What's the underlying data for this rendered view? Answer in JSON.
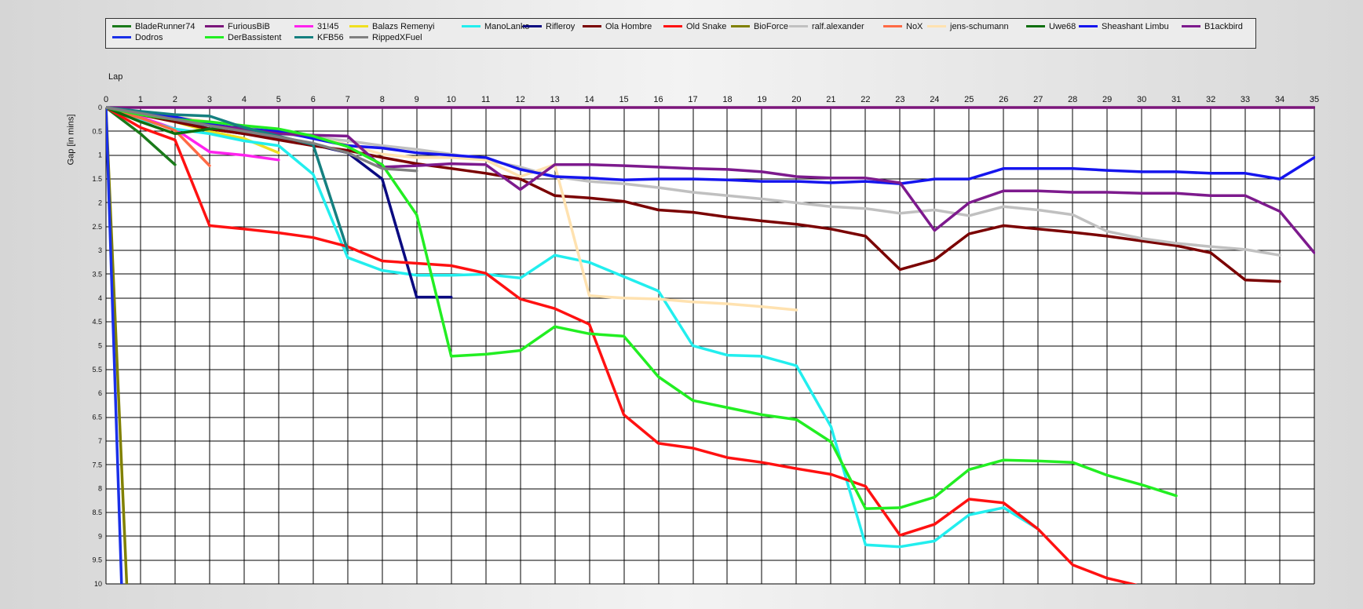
{
  "chart_data": {
    "type": "line",
    "xlabel": "Lap",
    "ylabel": "Gap [in mins]",
    "xlim": [
      0,
      35
    ],
    "ylim": [
      0,
      10
    ],
    "y_inverted": true,
    "x_ticks": [
      "0",
      "1",
      "2",
      "3",
      "4",
      "5",
      "6",
      "7",
      "8",
      "9",
      "10",
      "11",
      "12",
      "13",
      "14",
      "15",
      "16",
      "17",
      "18",
      "19",
      "20",
      "21",
      "22",
      "23",
      "24",
      "25",
      "26",
      "27",
      "28",
      "29",
      "30",
      "31",
      "32",
      "33",
      "34",
      "35"
    ],
    "y_ticks": [
      "0",
      "0.5",
      "1",
      "1.5",
      "2",
      "2.5",
      "3",
      "3.5",
      "4",
      "4.5",
      "5",
      "5.5",
      "6",
      "6.5",
      "7",
      "7.5",
      "8",
      "8.5",
      "9",
      "9.5",
      "10"
    ],
    "grid": true,
    "legend_position": "top",
    "series": [
      {
        "name": "BladeRunner74",
        "color": "#1a7a1a",
        "x": [
          0,
          1,
          2
        ],
        "y": [
          0,
          0.55,
          1.2
        ]
      },
      {
        "name": "FuriousBiB",
        "color": "#7b167b",
        "x": [
          0,
          35
        ],
        "y": [
          0,
          0
        ]
      },
      {
        "name": "31!45",
        "color": "#ff22ee",
        "x": [
          0,
          1,
          2,
          3,
          4,
          5
        ],
        "y": [
          0,
          0.2,
          0.45,
          0.93,
          1.0,
          1.1
        ]
      },
      {
        "name": "Balazs Remenyi",
        "color": "#f0e020",
        "x": [
          0,
          1,
          2,
          3,
          4,
          5
        ],
        "y": [
          0,
          0.15,
          0.3,
          0.5,
          0.65,
          0.95
        ]
      },
      {
        "name": "ManoLanko",
        "color": "#22eeee",
        "x": [
          0,
          1,
          2,
          3,
          4,
          5,
          6,
          7,
          8,
          9,
          10,
          11,
          12,
          13,
          14,
          15,
          16,
          17,
          18,
          19,
          20,
          21,
          22,
          23,
          24,
          25,
          26,
          27
        ],
        "y": [
          0,
          0.25,
          0.45,
          0.55,
          0.7,
          0.8,
          1.4,
          3.15,
          3.42,
          3.52,
          3.52,
          3.5,
          3.58,
          3.1,
          3.25,
          3.55,
          3.85,
          5.0,
          5.2,
          5.22,
          5.42,
          6.7,
          9.18,
          9.22,
          9.1,
          8.55,
          8.4,
          8.85
        ]
      },
      {
        "name": "Rifleroy",
        "color": "#0a0a80",
        "x": [
          0,
          1,
          2,
          3,
          4,
          5,
          6,
          7,
          8,
          9,
          10
        ],
        "y": [
          0,
          0.12,
          0.25,
          0.45,
          0.55,
          0.65,
          0.78,
          0.95,
          1.5,
          3.98,
          3.98
        ]
      },
      {
        "name": "Ola Hombre",
        "color": "#7a0000",
        "x": [
          0,
          1,
          2,
          3,
          4,
          5,
          6,
          7,
          8,
          9,
          10,
          11,
          12,
          13,
          14,
          15,
          16,
          17,
          18,
          19,
          20,
          21,
          22,
          23,
          24,
          25,
          26,
          27,
          28,
          29,
          30,
          31,
          32,
          33,
          34
        ],
        "y": [
          0,
          0.15,
          0.3,
          0.45,
          0.55,
          0.68,
          0.8,
          0.9,
          1.05,
          1.18,
          1.28,
          1.38,
          1.5,
          1.85,
          1.9,
          1.97,
          2.15,
          2.2,
          2.3,
          2.38,
          2.45,
          2.55,
          2.7,
          3.4,
          3.2,
          2.65,
          2.48,
          2.55,
          2.62,
          2.7,
          2.8,
          2.9,
          3.05,
          3.62,
          3.65
        ]
      },
      {
        "name": "Old Snake",
        "color": "#ff1111",
        "x": [
          0,
          1,
          2,
          3,
          4,
          5,
          6,
          7,
          8,
          9,
          10,
          11,
          12,
          13,
          14,
          15,
          16,
          17,
          18,
          19,
          20,
          21,
          22,
          23,
          24,
          25,
          26,
          27,
          28,
          29,
          30
        ],
        "y": [
          0,
          0.42,
          0.68,
          2.48,
          2.55,
          2.63,
          2.73,
          2.92,
          3.22,
          3.27,
          3.32,
          3.48,
          4.02,
          4.22,
          4.55,
          6.45,
          7.05,
          7.15,
          7.35,
          7.45,
          7.58,
          7.7,
          7.95,
          8.98,
          8.75,
          8.22,
          8.3,
          8.85,
          9.6,
          9.88,
          10.05
        ]
      },
      {
        "name": "BioForce",
        "color": "#808000",
        "x": [
          0,
          0.6
        ],
        "y": [
          0,
          10
        ]
      },
      {
        "name": "ralf.alexander",
        "color": "#c0c0c0",
        "x": [
          0,
          1,
          2,
          3,
          4,
          5,
          6,
          7,
          8,
          9,
          10,
          11,
          12,
          13,
          14,
          15,
          16,
          17,
          18,
          19,
          20,
          21,
          22,
          23,
          24,
          25,
          26,
          27,
          28,
          29,
          30,
          31,
          32,
          33,
          34
        ],
        "y": [
          0,
          0.1,
          0.22,
          0.35,
          0.45,
          0.55,
          0.62,
          0.7,
          0.8,
          0.88,
          0.98,
          1.1,
          1.25,
          1.45,
          1.55,
          1.6,
          1.68,
          1.78,
          1.85,
          1.92,
          2.0,
          2.08,
          2.12,
          2.22,
          2.15,
          2.27,
          2.08,
          2.15,
          2.25,
          2.6,
          2.75,
          2.85,
          2.92,
          2.98,
          3.1
        ]
      },
      {
        "name": "NoX",
        "color": "#ff6a45",
        "x": [
          0,
          1,
          2,
          3
        ],
        "y": [
          0,
          0.22,
          0.48,
          1.22
        ]
      },
      {
        "name": "jens-schumann",
        "color": "#ffe2b0",
        "x": [
          0,
          1,
          2,
          3,
          4,
          5,
          6,
          7,
          8,
          9,
          10,
          11,
          12,
          13,
          14,
          15,
          16,
          17,
          18,
          19,
          20
        ],
        "y": [
          0,
          0.1,
          0.2,
          0.3,
          0.4,
          0.5,
          0.62,
          0.78,
          0.98,
          1.05,
          1.05,
          1.1,
          1.45,
          1.2,
          3.95,
          4.0,
          4.02,
          4.08,
          4.12,
          4.18,
          4.25
        ]
      },
      {
        "name": "Uwe68",
        "color": "#0e6e0e",
        "x": [
          0,
          1,
          2,
          3,
          4
        ],
        "y": [
          0,
          0.3,
          0.55,
          0.45,
          0.4
        ]
      },
      {
        "name": "Sheashant Limbu",
        "color": "#1515ee",
        "x": [
          0,
          1,
          2,
          3,
          4,
          5,
          6,
          7,
          8,
          9,
          10,
          11,
          12,
          13,
          14,
          15,
          16,
          17,
          18,
          19,
          20,
          21,
          22,
          23,
          24,
          25,
          26,
          27,
          28,
          29,
          30,
          31,
          32,
          33,
          34,
          35
        ],
        "y": [
          0,
          0.1,
          0.2,
          0.35,
          0.45,
          0.5,
          0.65,
          0.8,
          0.85,
          0.95,
          1.0,
          1.05,
          1.3,
          1.45,
          1.48,
          1.52,
          1.5,
          1.5,
          1.52,
          1.55,
          1.55,
          1.58,
          1.55,
          1.6,
          1.5,
          1.5,
          1.28,
          1.28,
          1.28,
          1.32,
          1.35,
          1.35,
          1.38,
          1.38,
          1.5,
          1.05
        ]
      },
      {
        "name": "B1ackbird",
        "color": "#7d1a8d",
        "x": [
          0,
          1,
          2,
          3,
          4,
          5,
          6,
          7,
          8,
          9,
          10,
          11,
          12,
          13,
          14,
          15,
          16,
          17,
          18,
          19,
          20,
          21,
          22,
          23,
          24,
          25,
          26,
          27,
          28,
          29,
          30,
          31,
          32,
          33,
          34,
          35
        ],
        "y": [
          0,
          0.15,
          0.25,
          0.38,
          0.45,
          0.55,
          0.58,
          0.6,
          1.25,
          1.22,
          1.18,
          1.2,
          1.72,
          1.2,
          1.2,
          1.22,
          1.25,
          1.28,
          1.3,
          1.35,
          1.45,
          1.48,
          1.48,
          1.58,
          2.58,
          2.0,
          1.75,
          1.75,
          1.78,
          1.78,
          1.8,
          1.8,
          1.85,
          1.85,
          2.18,
          3.05
        ]
      },
      {
        "name": "Dodros",
        "color": "#1a30e8",
        "x": [
          0,
          0.45
        ],
        "y": [
          0,
          10
        ]
      },
      {
        "name": "DerBassistent",
        "color": "#22ee22",
        "x": [
          0,
          1,
          2,
          3,
          4,
          5,
          6,
          7,
          8,
          9,
          10,
          11,
          12,
          13,
          14,
          15,
          16,
          17,
          18,
          19,
          20,
          21,
          22,
          23,
          24,
          25,
          26,
          27,
          28,
          29,
          30,
          31
        ],
        "y": [
          0,
          0.15,
          0.25,
          0.3,
          0.38,
          0.45,
          0.6,
          0.82,
          1.2,
          2.25,
          5.22,
          5.18,
          5.1,
          4.6,
          4.75,
          4.8,
          5.65,
          6.15,
          6.3,
          6.45,
          6.55,
          7.02,
          8.42,
          8.4,
          8.18,
          7.6,
          7.4,
          7.42,
          7.45,
          7.72,
          7.92,
          8.15
        ]
      },
      {
        "name": "KFB56",
        "color": "#158080",
        "x": [
          0,
          1,
          2,
          3,
          4,
          5,
          6,
          7
        ],
        "y": [
          0,
          0.08,
          0.15,
          0.18,
          0.42,
          0.6,
          0.78,
          3.0
        ]
      },
      {
        "name": "RippedXFuel",
        "color": "#808080",
        "x": [
          0,
          1,
          2,
          3,
          4,
          5,
          6,
          7,
          8,
          9
        ],
        "y": [
          0,
          0.12,
          0.25,
          0.38,
          0.5,
          0.62,
          0.75,
          0.95,
          1.28,
          1.33
        ]
      }
    ]
  }
}
